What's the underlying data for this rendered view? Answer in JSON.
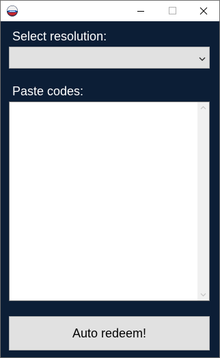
{
  "titlebar": {
    "app_icon": "redeem-app-icon",
    "minimize_icon": "minimize-icon",
    "maximize_icon": "maximize-icon",
    "close_icon": "close-icon"
  },
  "resolution": {
    "label": "Select resolution:",
    "selected_value": "",
    "dropdown_icon": "chevron-down-icon"
  },
  "codes": {
    "label": "Paste codes:",
    "value": ""
  },
  "actions": {
    "redeem_label": "Auto redeem!"
  },
  "colors": {
    "background": "#0c1e36",
    "titlebar": "#ffffff",
    "control": "#e1e1e1",
    "label_text": "#ffffff"
  }
}
